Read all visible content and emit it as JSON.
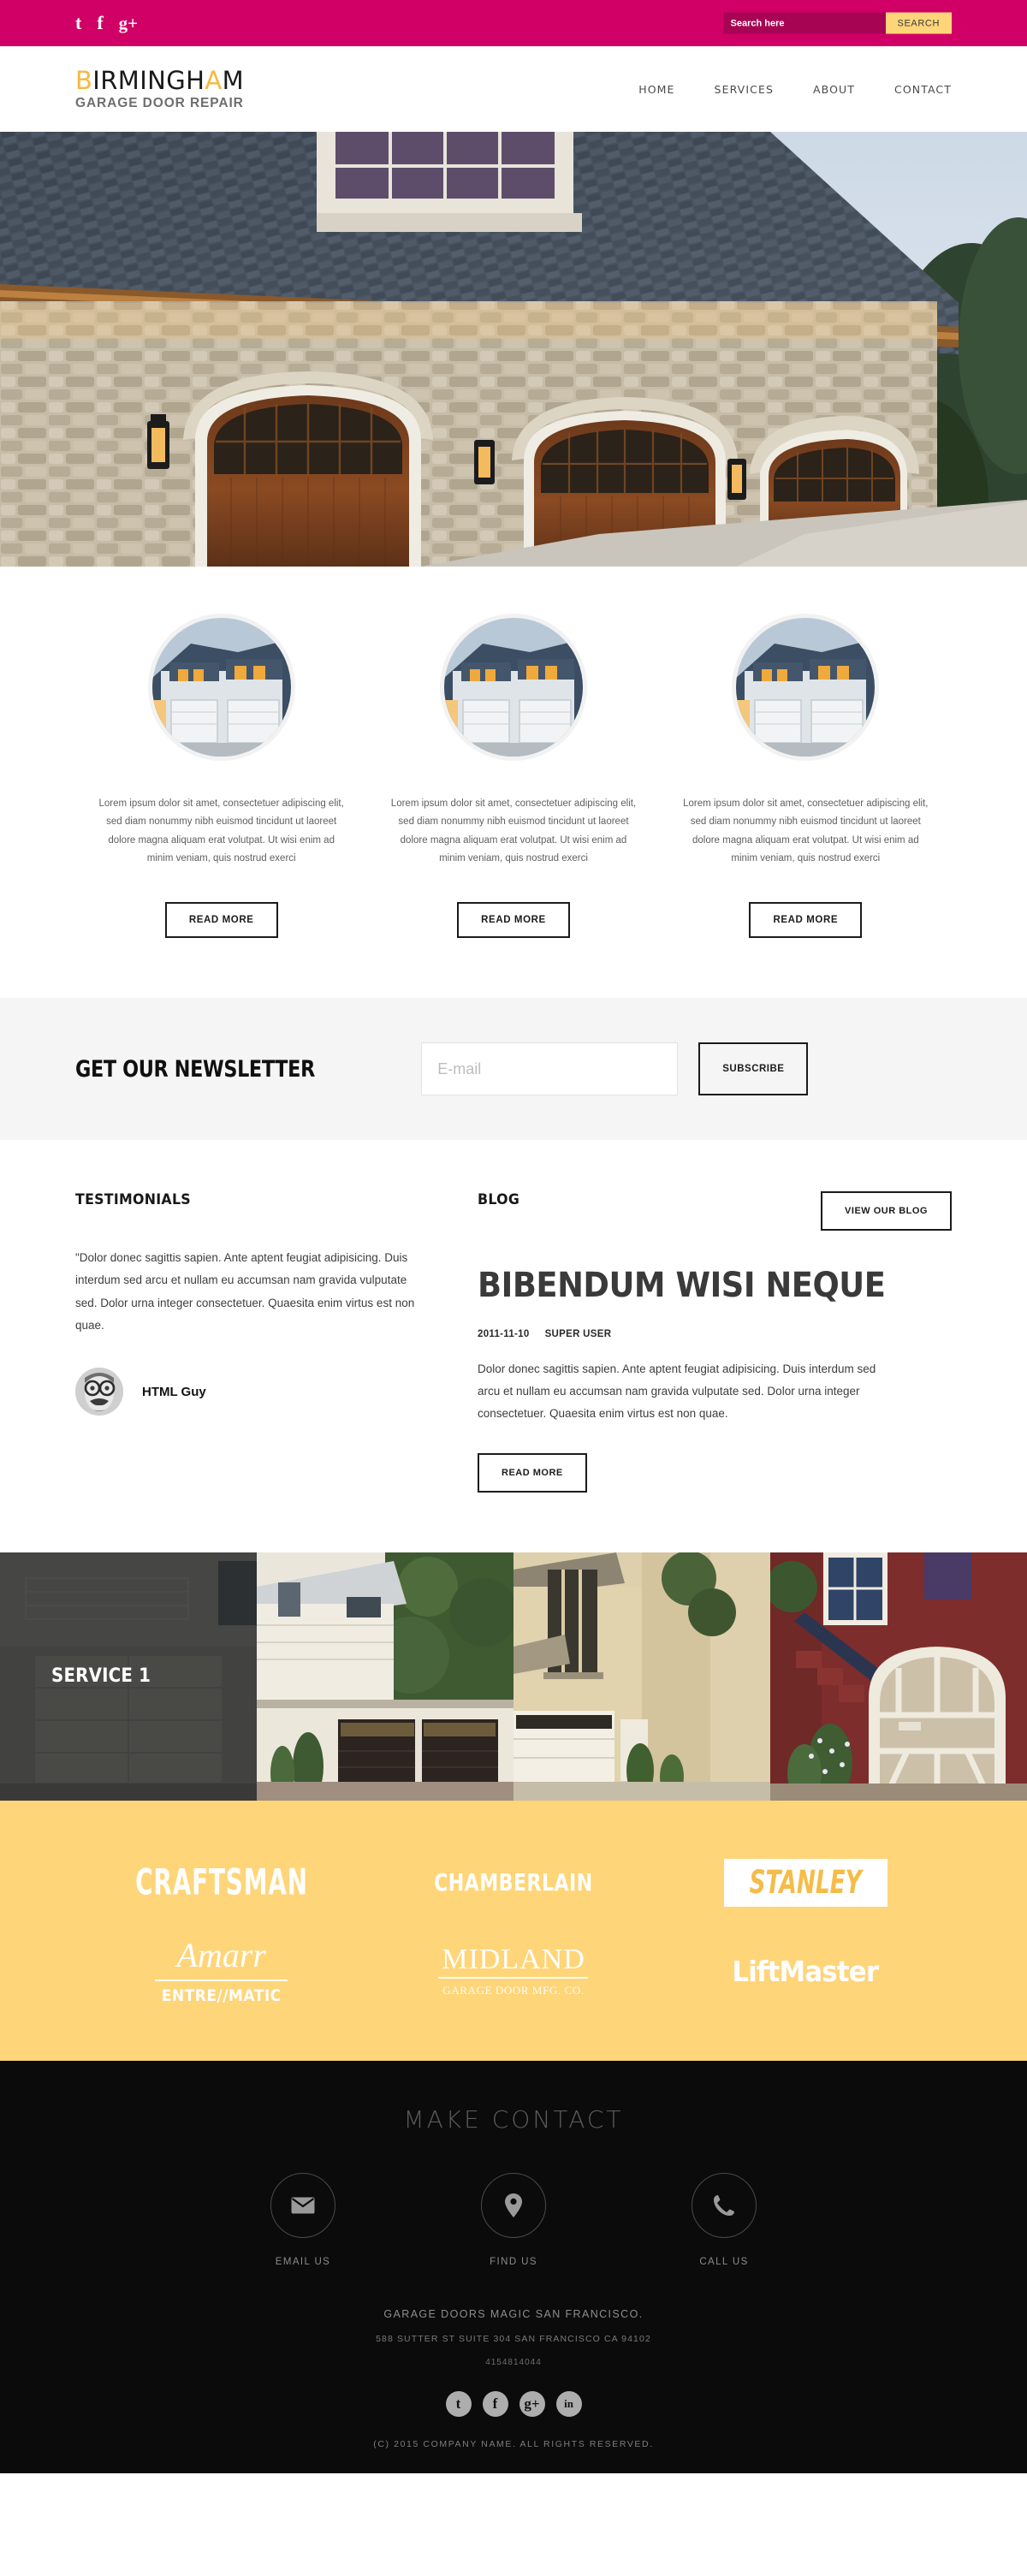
{
  "topbar": {
    "social": [
      {
        "name": "tumblr-icon",
        "glyph": "t"
      },
      {
        "name": "facebook-icon",
        "glyph": "f"
      },
      {
        "name": "googleplus-icon",
        "glyph": "g+"
      }
    ],
    "search_placeholder": "Search here",
    "search_value": "",
    "search_button": "SEARCH"
  },
  "header": {
    "logo_line1_a": "B",
    "logo_line1_b": "IRMINGH",
    "logo_line1_c": "A",
    "logo_line1_d": "M",
    "logo_line1_full": "BIRMINGHAM",
    "logo_line2": "GARAGE DOOR REPAIR",
    "nav": [
      {
        "label": "HOME"
      },
      {
        "label": "SERVICES"
      },
      {
        "label": "ABOUT"
      },
      {
        "label": "CONTACT"
      }
    ]
  },
  "hero": {
    "alt": "Stone house with three arched wooden garage doors at dusk"
  },
  "features": [
    {
      "image_alt": "Suburban house with two white garage doors at dusk",
      "text": "Lorem ipsum dolor sit amet, consectetuer adipiscing elit, sed diam nonummy nibh euismod tincidunt ut laoreet dolore magna aliquam erat volutpat. Ut wisi enim ad minim veniam, quis nostrud exerci",
      "button": "READ MORE"
    },
    {
      "image_alt": "Suburban house with two white garage doors at dusk",
      "text": "Lorem ipsum dolor sit amet, consectetuer adipiscing elit, sed diam nonummy nibh euismod tincidunt ut laoreet dolore magna aliquam erat volutpat. Ut wisi enim ad minim veniam, quis nostrud exerci",
      "button": "READ MORE"
    },
    {
      "image_alt": "Suburban house with two white garage doors at dusk",
      "text": "Lorem ipsum dolor sit amet, consectetuer adipiscing elit, sed diam nonummy nibh euismod tincidunt ut laoreet dolore magna aliquam erat volutpat. Ut wisi enim ad minim veniam, quis nostrud exerci",
      "button": "READ MORE"
    }
  ],
  "newsletter": {
    "title": "GET OUR NEWSLETTER",
    "input_placeholder": "E-mail",
    "input_value": "",
    "button": "SUBSCRIBE"
  },
  "testimonials": {
    "title": "TESTIMONIALS",
    "quote": "\"Dolor donec sagittis sapien. Ante aptent feugiat adipisicing. Duis interdum sed arcu et nullam eu accumsan nam gravida vulputate sed. Dolor urna integer consectetuer. Quaesita enim virtus est non quae.",
    "author": "HTML Guy",
    "author_image_alt": "Black and white portrait of man with round glasses and moustache"
  },
  "blog": {
    "title": "BLOG",
    "view_button": "VIEW OUR BLOG",
    "post_title": "BIBENDUM WISI NEQUE",
    "post_date": "2011-11-10",
    "post_author": "SUPER USER",
    "post_body": "Dolor donec sagittis sapien. Ante aptent feugiat adipisicing. Duis interdum sed arcu et nullam eu accumsan nam gravida vulputate sed. Dolor urna integer consectetuer. Quaesita enim virtus est non quae.",
    "read_more": "READ MORE"
  },
  "gallery": {
    "items": [
      {
        "label": "SERVICE 1",
        "overlay": true,
        "alt": "Grey garage door panel"
      },
      {
        "label": "",
        "overlay": false,
        "alt": "White house with two dark brown garage doors"
      },
      {
        "label": "",
        "overlay": false,
        "alt": "Beige two story house with white garage door"
      },
      {
        "label": "",
        "overlay": false,
        "alt": "Red stucco house with arched white garage door"
      }
    ]
  },
  "brands": {
    "row1": [
      {
        "name": "CRAFTSMAN"
      },
      {
        "name": "CHAMBERLAIN"
      },
      {
        "name": "STANLEY"
      }
    ],
    "row2": [
      {
        "name": "Amarr",
        "sub": "ENTRE//MATIC"
      },
      {
        "name": "MIDLAND",
        "sub": "GARAGE DOOR MFG. CO."
      },
      {
        "name": "LiftMaster"
      }
    ]
  },
  "footer": {
    "heading": "MAKE CONTACT",
    "contacts": [
      {
        "icon": "envelope-icon",
        "label": "EMAIL US"
      },
      {
        "icon": "map-pin-icon",
        "label": "FIND US"
      },
      {
        "icon": "phone-icon",
        "label": "CALL US"
      }
    ],
    "company": "GARAGE DOORS MAGIC SAN FRANCISCO.",
    "address": "588 SUTTER ST SUITE 304 SAN FRANCISCO CA 94102",
    "phone": "4154814044",
    "social": [
      {
        "name": "tumblr-icon",
        "glyph": "t"
      },
      {
        "name": "facebook-icon",
        "glyph": "f"
      },
      {
        "name": "googleplus-icon",
        "glyph": "g+"
      },
      {
        "name": "linkedin-icon",
        "glyph": "in"
      }
    ],
    "copyright": "(C) 2015 COMPANY NAME. ALL RIGHTS RESERVED."
  },
  "colors": {
    "pink": "#d10066",
    "yellow": "#ffd579",
    "dark": "#0b0b0b",
    "grey_bg": "#f5f5f5"
  }
}
